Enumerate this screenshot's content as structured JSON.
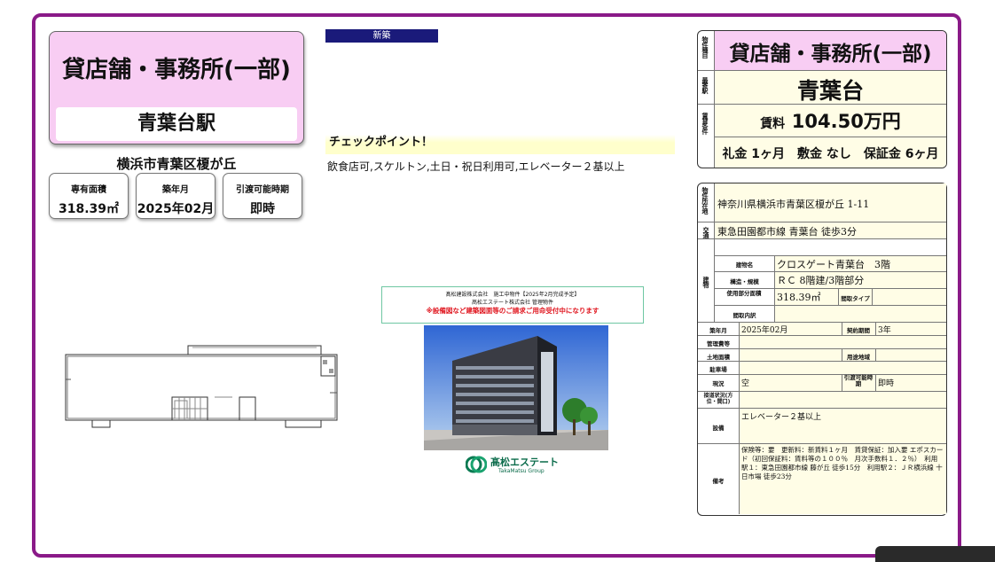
{
  "summary": {
    "property_type": "貸店舗・事務所(一部)",
    "station": "青葉台駅",
    "address_short": "横浜市青葉区榎が丘",
    "area_label": "専有面積",
    "area_value": "318.39㎡",
    "built_label": "築年月",
    "built_value": "2025年02月",
    "handover_label": "引渡可能時期",
    "handover_value": "即時"
  },
  "middle": {
    "new_badge": "新築",
    "checkpoint_title": "チェックポイント！",
    "checkpoint_text": "飲食店可,スケルトン,土日・祝日利用可,エレベーター２基以上",
    "notice_line1": "髙松建設株式会社　施工中物件【2025年2月完成予定】",
    "notice_line2": "髙松エステート株式会社 管理物件",
    "notice_line3": "※設備図など建築図面等のご請求ご用命受付中になります",
    "logo_name": "髙松エステート",
    "logo_sub": "TakaMatsu Group"
  },
  "right_top": {
    "type_label": "物件種目",
    "type_value": "貸店舗・事務所(一部)",
    "nearest_label": "最寄駅",
    "nearest_value": "青葉台",
    "cond_label": "賃貸条件",
    "rent_label": "賃料",
    "rent_value": "104.50万円",
    "terms": "礼金 1ヶ月　敷金 なし　保証金 6ヶ月"
  },
  "details": {
    "location_label": "物件所在地",
    "location_value": "神奈川県横浜市青葉区榎が丘 1-11",
    "transport_label": "交通",
    "transport_value": "東急田園都市線 青葉台 徒歩3分",
    "building_label": "建物",
    "bname_label": "建物名",
    "bname_value": "クロスゲート青葉台　3階",
    "structure_label": "構造・規模",
    "structure_value": "ＲＣ 8階建/3階部分",
    "usage_label": "使用部分面積",
    "usage_value": "318.39㎡",
    "layout_type_label": "間取タイプ",
    "layout_detail_label": "間取内訳",
    "built_label": "築年月",
    "built_value": "2025年02月",
    "contract_label": "契約期間",
    "contract_value": "3年",
    "mgmt_label": "管理費等",
    "land_label": "土地面積",
    "zoning_label": "用途地域",
    "parking_label": "駐車場",
    "status_label": "現況",
    "status_value": "空",
    "handover_label": "引渡可能時期",
    "handover_value": "即時",
    "access_label": "接道状況(方位・間口)",
    "facility_label": "設備",
    "facility_value": "エレベーター２基以上",
    "remarks_label": "備考",
    "remarks_value": "保険等：要　更新料：新賃料１ヶ月　賃貸保証：加入要 エポスカード（初回保証料：賃料等の１００％　月次手数料１．２％）　利用駅１：東急田園都市線 藤が丘 徒歩15分　利用駅２：ＪＲ横浜線 十日市場 徒歩23分"
  }
}
